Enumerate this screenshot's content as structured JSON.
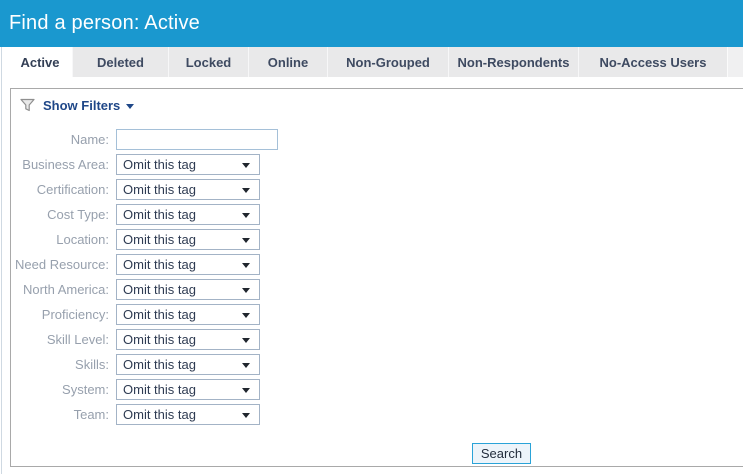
{
  "header": {
    "title": "Find a person: Active"
  },
  "tabs": [
    "Active",
    "Deleted",
    "Locked",
    "Online",
    "Non-Grouped",
    "Non-Respondents",
    "No-Access Users"
  ],
  "active_tab": "Active",
  "filters": {
    "toggle_label": "Show Filters",
    "rows": [
      {
        "label": "Name:",
        "type": "text",
        "value": ""
      },
      {
        "label": "Business Area:",
        "type": "select",
        "value": "Omit this tag"
      },
      {
        "label": "Certification:",
        "type": "select",
        "value": "Omit this tag"
      },
      {
        "label": "Cost Type:",
        "type": "select",
        "value": "Omit this tag"
      },
      {
        "label": "Location:",
        "type": "select",
        "value": "Omit this tag"
      },
      {
        "label": "Need Resource:",
        "type": "select",
        "value": "Omit this tag"
      },
      {
        "label": "North America:",
        "type": "select",
        "value": "Omit this tag"
      },
      {
        "label": "Proficiency:",
        "type": "select",
        "value": "Omit this tag"
      },
      {
        "label": "Skill Level:",
        "type": "select",
        "value": "Omit this tag"
      },
      {
        "label": "Skills:",
        "type": "select",
        "value": "Omit this tag"
      },
      {
        "label": "System:",
        "type": "select",
        "value": "Omit this tag"
      },
      {
        "label": "Team:",
        "type": "select",
        "value": "Omit this tag"
      }
    ],
    "search_label": "Search"
  },
  "icons": {
    "filter_toggle": "funnel-icon",
    "filter_toggle_caret": "caret-down-icon",
    "select_caret": "caret-down-icon"
  },
  "colors": {
    "header_bg": "#1a98cf",
    "tab_bg": "#e9e9ea",
    "tab_text": "#3e4a61",
    "panel_border": "#a9a9a9",
    "label_text": "#97a0ad",
    "value_text": "#2e3b52",
    "link_blue": "#1f4788",
    "accent_cyan": "#2aa3d8"
  }
}
